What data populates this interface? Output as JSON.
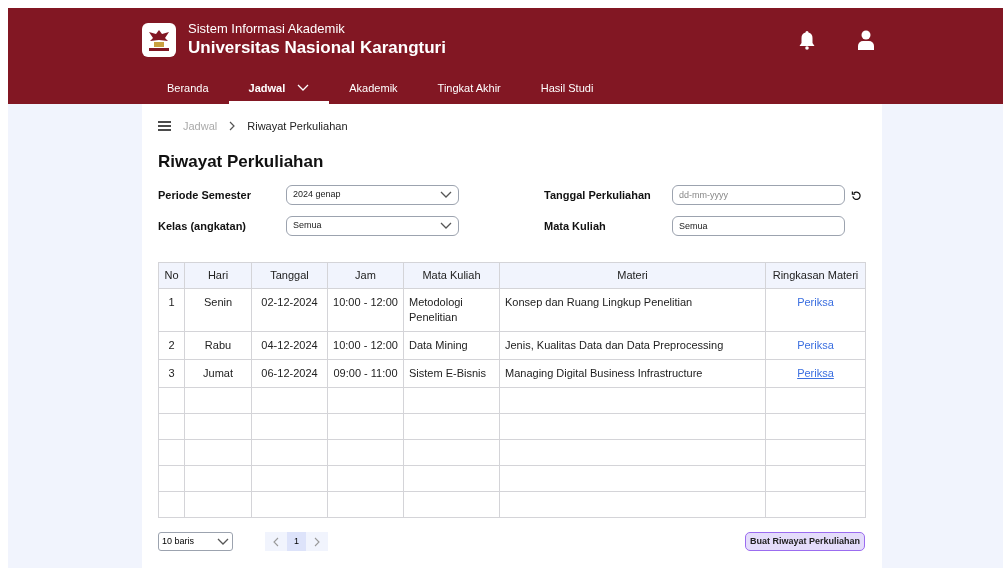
{
  "header": {
    "subtitle": "Sistem Informasi Akademik",
    "title": "Universitas Nasional Karangturi"
  },
  "nav": [
    {
      "label": "Beranda",
      "selected": false,
      "dropdown": false
    },
    {
      "label": "Jadwal",
      "selected": true,
      "dropdown": true
    },
    {
      "label": "Akademik",
      "selected": false,
      "dropdown": false
    },
    {
      "label": "Tingkat Akhir",
      "selected": false,
      "dropdown": false
    },
    {
      "label": "Hasil Studi",
      "selected": false,
      "dropdown": false
    }
  ],
  "breadcrumb": [
    "Jadwal",
    "Riwayat Perkuliahan"
  ],
  "page_title": "Riwayat Perkuliahan",
  "filters": [
    {
      "label": "Periode Semester",
      "kind": "select",
      "value": "2024 genap"
    },
    {
      "label": "Tanggal Perkuliahan",
      "kind": "date",
      "placeholder": "dd-mm-yyyy"
    },
    {
      "label": "Kelas (angkatan)",
      "kind": "select",
      "value": "Semua"
    },
    {
      "label": "Mata Kuliah",
      "kind": "text",
      "value": "Semua"
    }
  ],
  "table": {
    "columns": [
      "No",
      "Hari",
      "Tanggal",
      "Jam",
      "Mata Kuliah",
      "Materi",
      "Ringkasan Materi"
    ],
    "rows": [
      {
        "cells": [
          "1",
          "Senin",
          "02-12-2024",
          "10:00 - 12:00",
          "Metodologi Penelitian",
          "Konsep dan Ruang Lingkup Penelitian"
        ],
        "link": "Periksa",
        "underlined": false
      },
      {
        "cells": [
          "2",
          "Rabu",
          "04-12-2024",
          "10:00 - 12:00",
          "Data Mining",
          "Jenis, Kualitas Data dan Data Preprocessing"
        ],
        "link": "Periksa",
        "underlined": false
      },
      {
        "cells": [
          "3",
          "Jumat",
          "06-12-2024",
          "09:00 - 11:00",
          "Sistem E-Bisnis",
          "Managing Digital Business Infrastructure"
        ],
        "link": "Periksa",
        "underlined": true
      }
    ]
  },
  "pagination": {
    "page_size": "10 baris",
    "pages": [
      {
        "label": "1",
        "selected": true
      }
    ]
  },
  "create_button": "Buat Riwayat Perkuliahan"
}
